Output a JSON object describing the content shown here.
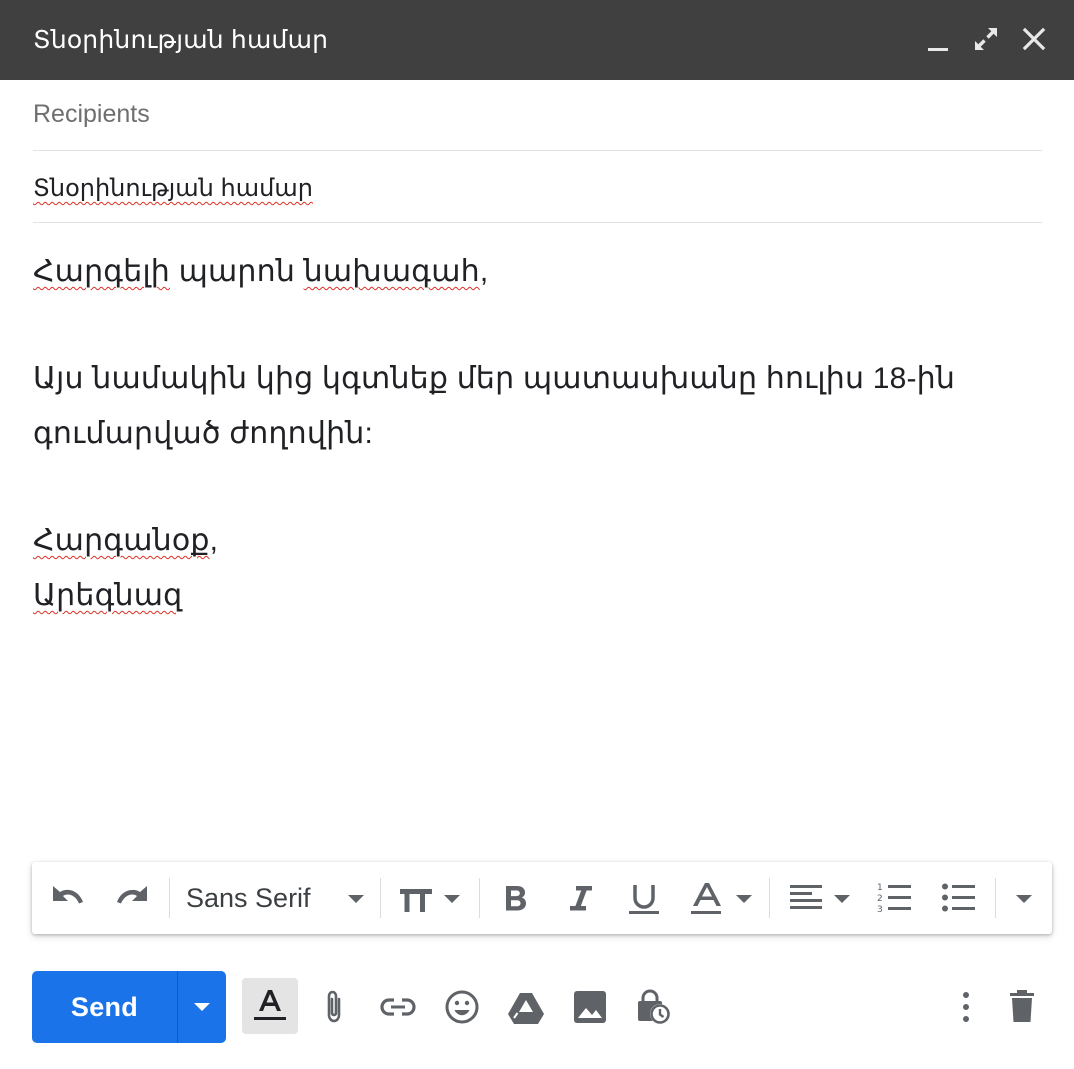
{
  "window": {
    "title": "Տնօրինության համար"
  },
  "compose": {
    "recipients_placeholder": "Recipients",
    "subject": "Տնօրինության համար",
    "body": {
      "greeting_word1": "Հարգելի",
      "greeting_word2": "պարոն",
      "greeting_word3": "նախագահ",
      "greeting_punct": ",",
      "line2": "Այս նամակին կից կգտնեք մեր պատասխանը հուլիս 18-ին",
      "line3": "գումարված ժողովին:",
      "closing_word": "Հարգանօք",
      "closing_punct": ",",
      "signature": "Արեգնազ"
    }
  },
  "format_toolbar": {
    "font_name": "Sans Serif"
  },
  "actions": {
    "send_label": "Send"
  },
  "colors": {
    "titlebar_bg": "#404040",
    "accent": "#1a73e8",
    "spellcheck": "#d93025",
    "icon": "#5f6368"
  }
}
